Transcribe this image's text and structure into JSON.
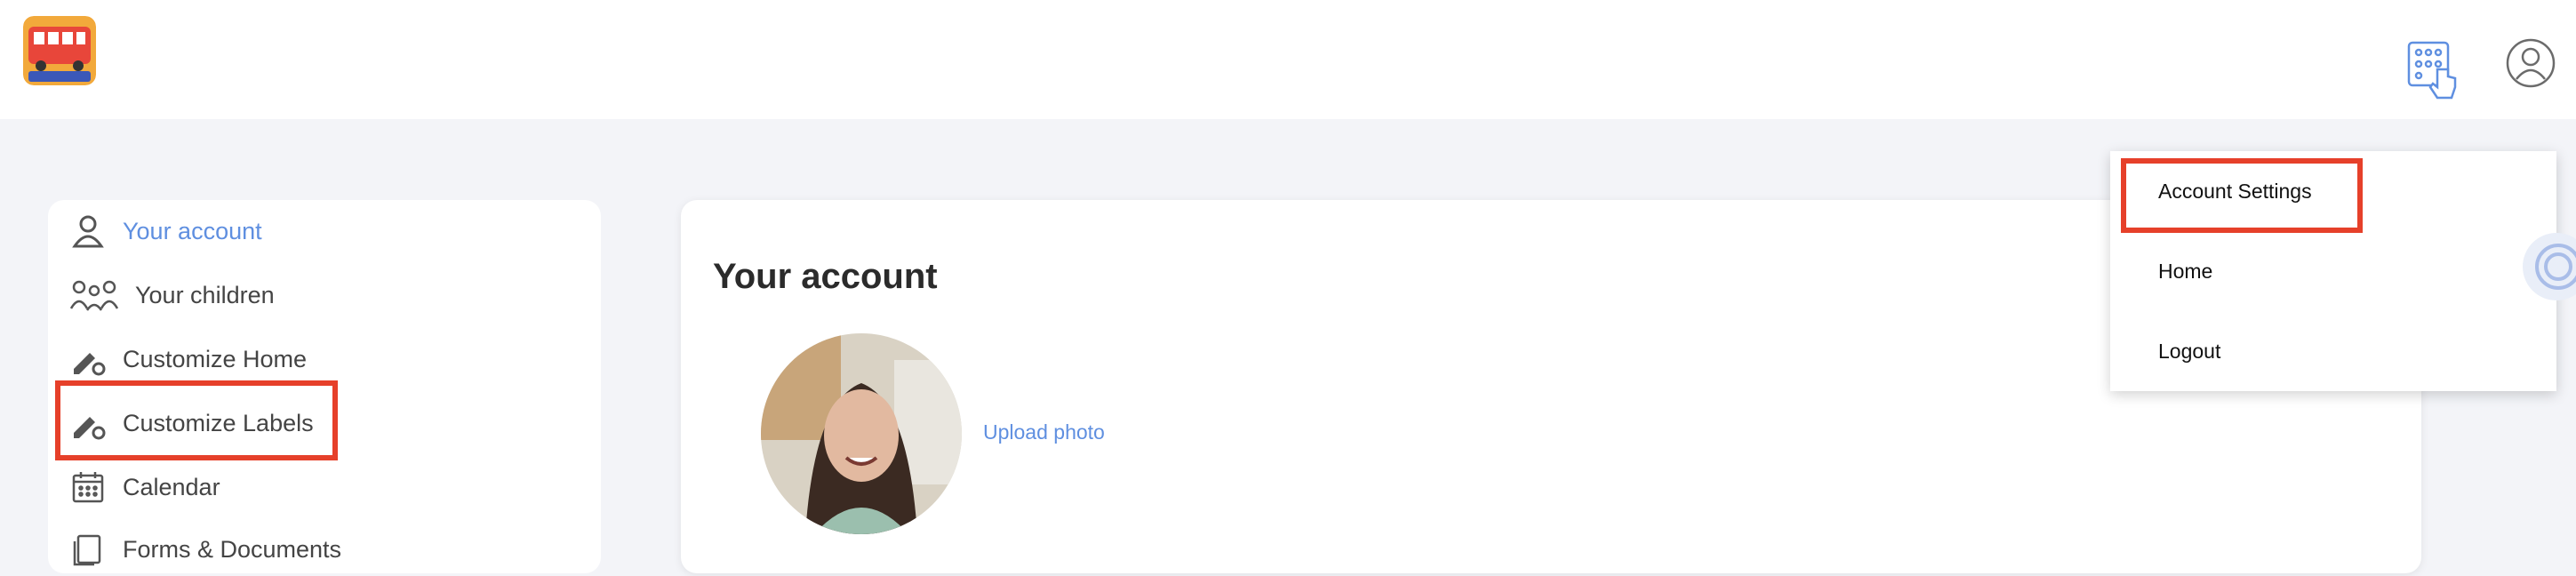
{
  "app": {
    "logo_text": "MAGIC BUS"
  },
  "header": {
    "keypad_icon": "keypad-touch-icon",
    "profile_icon": "user-circle-icon"
  },
  "sidebar": {
    "items": [
      {
        "label": "Your account",
        "icon": "user-icon",
        "active": true
      },
      {
        "label": "Your children",
        "icon": "family-icon"
      },
      {
        "label": "Customize Home",
        "icon": "pencil-gear-icon"
      },
      {
        "label": "Customize Labels",
        "icon": "pencil-gear-icon"
      },
      {
        "label": "Calendar",
        "icon": "calendar-icon"
      },
      {
        "label": "Forms & Documents",
        "icon": "documents-icon"
      }
    ]
  },
  "main": {
    "title": "Your account",
    "upload_label": "Upload photo"
  },
  "menu": {
    "items": [
      {
        "label": "Account Settings"
      },
      {
        "label": "Home"
      },
      {
        "label": "Logout"
      }
    ]
  },
  "colors": {
    "accent": "#5f8fe0",
    "highlight": "#e6402a",
    "background": "#f3f4f8"
  }
}
